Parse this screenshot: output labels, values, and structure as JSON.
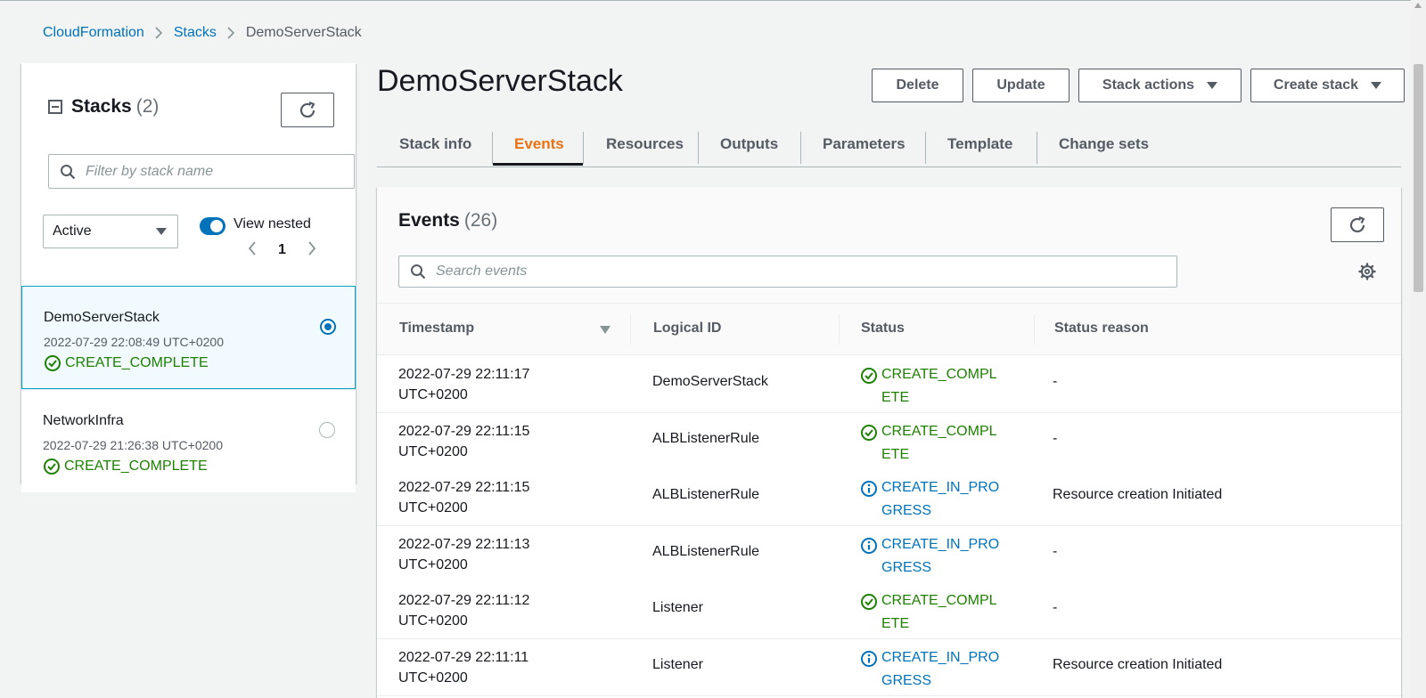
{
  "breadcrumbs": {
    "items": [
      "CloudFormation",
      "Stacks"
    ],
    "current": "DemoServerStack"
  },
  "left_panel": {
    "title": "Stacks",
    "count": "(2)",
    "filter_placeholder": "Filter by stack name",
    "status_filter": "Active",
    "view_nested_label": "View nested",
    "page": "1",
    "stacks": [
      {
        "name": "DemoServerStack",
        "time": "2022-07-29 22:08:49 UTC+0200",
        "status": "CREATE_COMPLETE",
        "selected": true
      },
      {
        "name": "NetworkInfra",
        "time": "2022-07-29 21:26:38 UTC+0200",
        "status": "CREATE_COMPLETE",
        "selected": false
      }
    ]
  },
  "main": {
    "title": "DemoServerStack",
    "buttons": {
      "delete": "Delete",
      "update": "Update",
      "stack_actions": "Stack actions",
      "create_stack": "Create stack"
    },
    "tabs": [
      "Stack info",
      "Events",
      "Resources",
      "Outputs",
      "Parameters",
      "Template",
      "Change sets"
    ],
    "active_tab": "Events"
  },
  "events": {
    "title": "Events",
    "count": "(26)",
    "search_placeholder": "Search events",
    "columns": [
      "Timestamp",
      "Logical ID",
      "Status",
      "Status reason"
    ],
    "rows": [
      {
        "ts1": "2022-07-29 22:11:17",
        "ts2": "UTC+0200",
        "logical_id": "DemoServerStack",
        "status": "CREATE_COMPLETE",
        "kind": "ok",
        "reason": "-"
      },
      {
        "ts1": "2022-07-29 22:11:15",
        "ts2": "UTC+0200",
        "logical_id": "ALBListenerRule",
        "status": "CREATE_COMPLETE",
        "kind": "ok",
        "reason": "-"
      },
      {
        "ts1": "2022-07-29 22:11:15",
        "ts2": "UTC+0200",
        "logical_id": "ALBListenerRule",
        "status": "CREATE_IN_PROGRESS",
        "kind": "prog",
        "reason": "Resource creation Initiated"
      },
      {
        "ts1": "2022-07-29 22:11:13",
        "ts2": "UTC+0200",
        "logical_id": "ALBListenerRule",
        "status": "CREATE_IN_PROGRESS",
        "kind": "prog",
        "reason": "-"
      },
      {
        "ts1": "2022-07-29 22:11:12",
        "ts2": "UTC+0200",
        "logical_id": "Listener",
        "status": "CREATE_COMPLETE",
        "kind": "ok",
        "reason": "-"
      },
      {
        "ts1": "2022-07-29 22:11:11",
        "ts2": "UTC+0200",
        "logical_id": "Listener",
        "status": "CREATE_IN_PROGRESS",
        "kind": "prog",
        "reason": "Resource creation Initiated"
      }
    ]
  },
  "colors": {
    "link": "#0073bb",
    "success": "#1d8102",
    "info": "#0073bb",
    "active_tab": "#ec7211"
  }
}
